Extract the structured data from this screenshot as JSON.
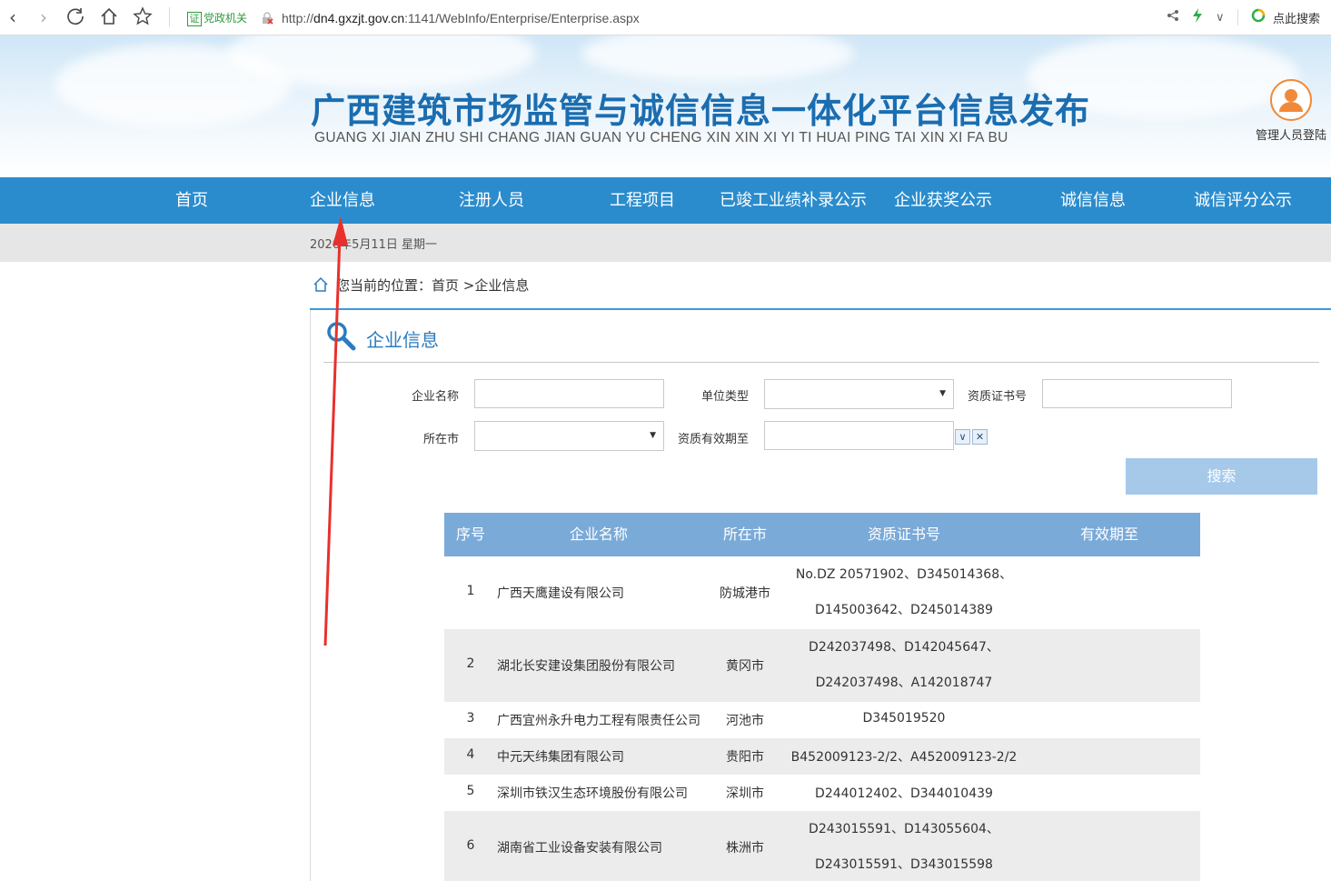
{
  "browser": {
    "gov_badge_icon": "证",
    "gov_badge": "党政机关",
    "url_prefix": "http://",
    "url_host": "dn4.gxzjt.gov.cn",
    "url_rest": ":1141/WebInfo/Enterprise/Enterprise.aspx",
    "search_label": "点此搜索"
  },
  "header": {
    "title": "广西建筑市场监管与诚信信息一体化平台信息发布",
    "subtitle": "GUANG XI JIAN ZHU SHI CHANG JIAN GUAN YU CHENG XIN XIN XI YI TI HUAI PING TAI XIN XI FA BU",
    "admin_label": "管理人员登陆"
  },
  "nav": [
    {
      "label": "首页"
    },
    {
      "label": "企业信息"
    },
    {
      "label": "注册人员"
    },
    {
      "label": "工程项目"
    },
    {
      "label": "已竣工业绩补录公示"
    },
    {
      "label": "企业获奖公示"
    },
    {
      "label": "诚信信息"
    },
    {
      "label": "诚信评分公示"
    }
  ],
  "date_text": "2020年5月11日 星期一",
  "breadcrumb": "您当前的位置：首页 >企业信息",
  "section_title": "企业信息",
  "form": {
    "company_name_label": "企业名称",
    "unit_type_label": "单位类型",
    "cert_no_label": "资质证书号",
    "city_label": "所在市",
    "valid_until_label": "资质有效期至",
    "search_button": "搜索"
  },
  "table": {
    "headers": [
      "序号",
      "企业名称",
      "所在市",
      "资质证书号",
      "有效期至"
    ],
    "rows": [
      {
        "no": "1",
        "name": "广西天鹰建设有限公司",
        "city": "防城港市",
        "cert1": "No.DZ 20571902、D345014368、",
        "cert2": "D145003642、D245014389",
        "expiry": ""
      },
      {
        "no": "2",
        "name": "湖北长安建设集团股份有限公司",
        "city": "黄冈市",
        "cert1": "D242037498、D142045647、",
        "cert2": "D242037498、A142018747",
        "expiry": ""
      },
      {
        "no": "3",
        "name": "广西宜州永升电力工程有限责任公司",
        "city": "河池市",
        "cert1": "D345019520",
        "cert2": "",
        "expiry": ""
      },
      {
        "no": "4",
        "name": "中元天纬集团有限公司",
        "city": "贵阳市",
        "cert1": "B452009123-2/2、A452009123-2/2",
        "cert2": "",
        "expiry": ""
      },
      {
        "no": "5",
        "name": "深圳市铁汉生态环境股份有限公司",
        "city": "深圳市",
        "cert1": "D244012402、D344010439",
        "cert2": "",
        "expiry": ""
      },
      {
        "no": "6",
        "name": "湖南省工业设备安装有限公司",
        "city": "株洲市",
        "cert1": "D243015591、D143055604、",
        "cert2": "D243015591、D343015598",
        "expiry": ""
      }
    ]
  },
  "colors": {
    "nav_bg": "#2b8ccd",
    "title_blue": "#1b6db0",
    "table_head": "#7aaad8",
    "search_btn": "#a6c9ea",
    "annotation_arrow": "#e8302c"
  }
}
